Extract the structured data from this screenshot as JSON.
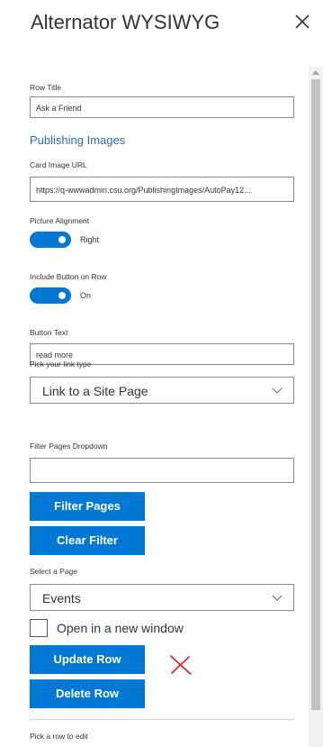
{
  "panel": {
    "title": "Alternator WYSIWYG"
  },
  "fields": {
    "row_title": {
      "label": "Row Title",
      "value": "Ask a Friend"
    },
    "section_link": "Publishing Images",
    "card_image_url": {
      "label": "Card Image URL",
      "value": "https://q-wwwadmin.csu.org/PublishingImages/AutoPay12..."
    },
    "picture_alignment": {
      "label": "Picture Alignment",
      "state_text": "Right",
      "on": true
    },
    "include_button": {
      "label": "Include Button on Row",
      "state_text": "On",
      "on": true
    },
    "button_text": {
      "label": "Button Text",
      "value": "read more"
    },
    "link_type": {
      "label": "Pick your link type",
      "selected": "Link to a Site Page"
    },
    "filter_pages": {
      "label": "Filter Pages Dropdown",
      "value": ""
    },
    "select_page": {
      "label": "Select a Page",
      "selected": "Events"
    },
    "open_new_window": {
      "label": "Open in a new window",
      "checked": false
    },
    "pick_row": {
      "label": "Pick a row to edit"
    }
  },
  "buttons": {
    "filter_pages": "Filter Pages",
    "clear_filter": "Clear Filter",
    "update_row": "Update Row",
    "delete_row": "Delete Row"
  },
  "icons": {
    "close": "close-icon",
    "chevron": "chevron-down-icon",
    "annotation": "red-x-mark"
  },
  "colors": {
    "accent": "#0078d4",
    "link": "#2b6cb8",
    "annotation": "#e8192c"
  }
}
